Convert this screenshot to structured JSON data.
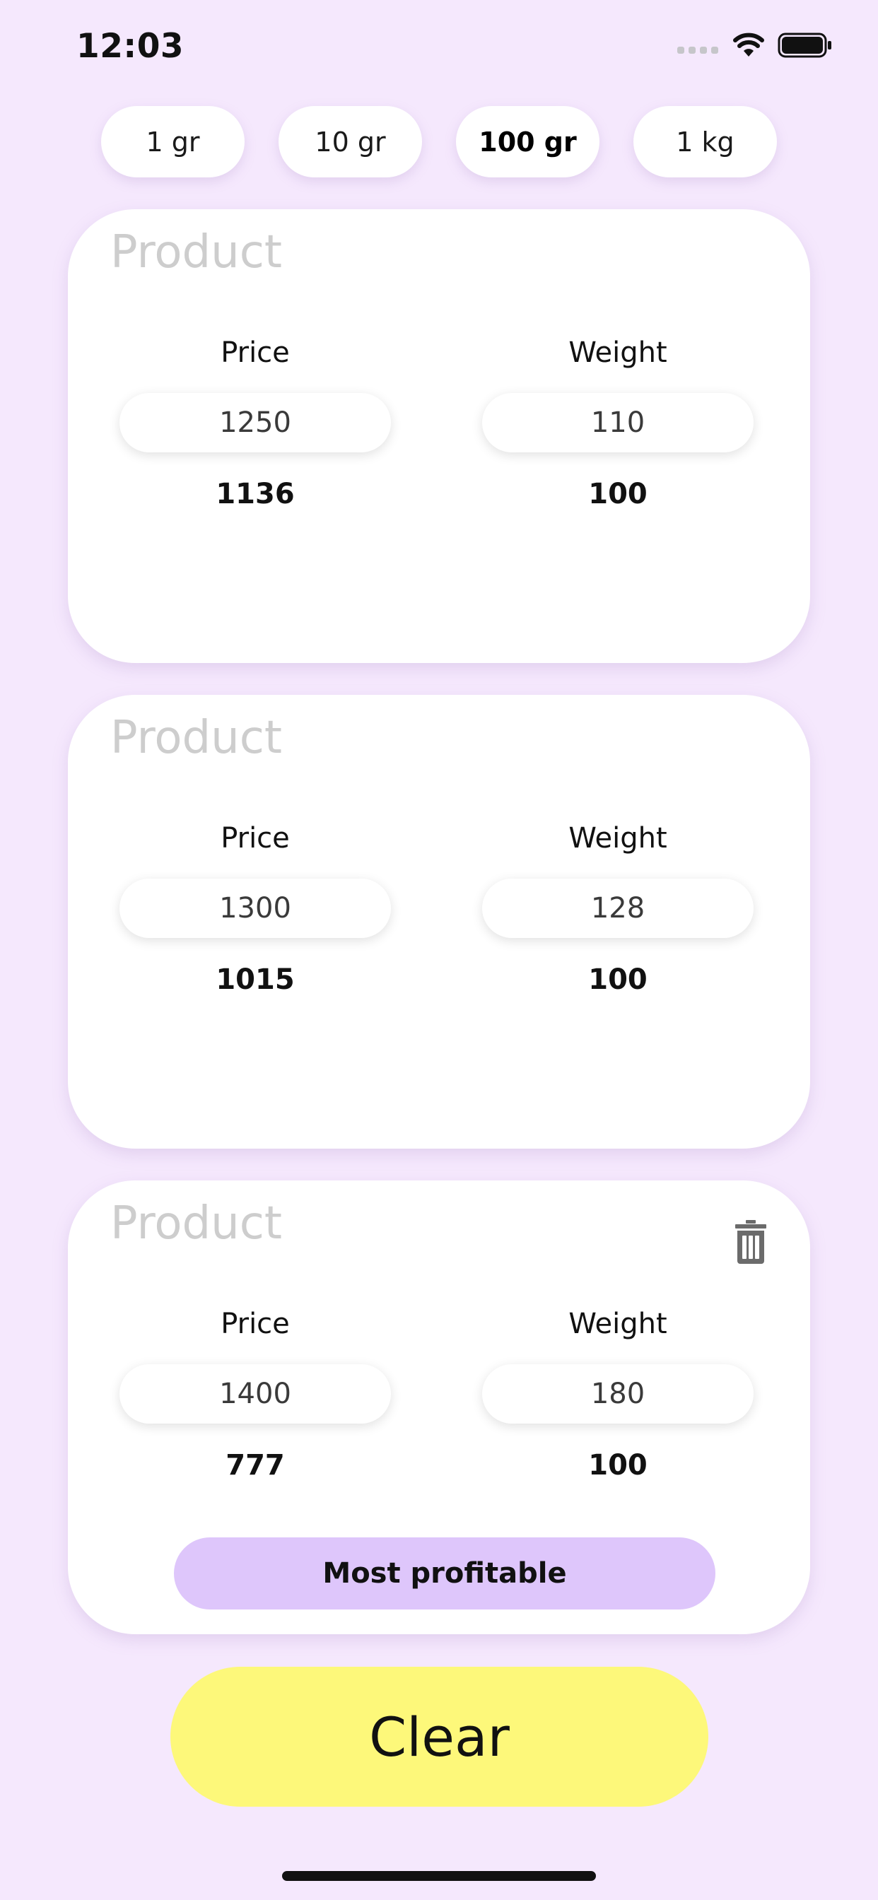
{
  "status_bar": {
    "time": "12:03"
  },
  "units": [
    {
      "label": "1 gr",
      "selected": false
    },
    {
      "label": "10 gr",
      "selected": false
    },
    {
      "label": "100 gr",
      "selected": true
    },
    {
      "label": "1 kg",
      "selected": false
    }
  ],
  "products": [
    {
      "name_placeholder": "Product",
      "price_label": "Price",
      "weight_label": "Weight",
      "price": "1250",
      "weight": "110",
      "price_per_unit": "1136",
      "unit_weight": "100"
    },
    {
      "name_placeholder": "Product",
      "price_label": "Price",
      "weight_label": "Weight",
      "price": "1300",
      "weight": "128",
      "price_per_unit": "1015",
      "unit_weight": "100"
    },
    {
      "name_placeholder": "Product",
      "price_label": "Price",
      "weight_label": "Weight",
      "price": "1400",
      "weight": "180",
      "price_per_unit": "777",
      "unit_weight": "100",
      "badge": "Most profitable"
    }
  ],
  "clear_label": "Clear",
  "icons": {
    "wifi": "wifi-icon",
    "battery": "battery-icon",
    "signal": "signal-icon",
    "trash": "trash-icon"
  },
  "colors": {
    "background": "#f5e8fd",
    "badge": "#dec6fb",
    "clear_button": "#fdf87a",
    "placeholder": "#cdcdcd"
  }
}
